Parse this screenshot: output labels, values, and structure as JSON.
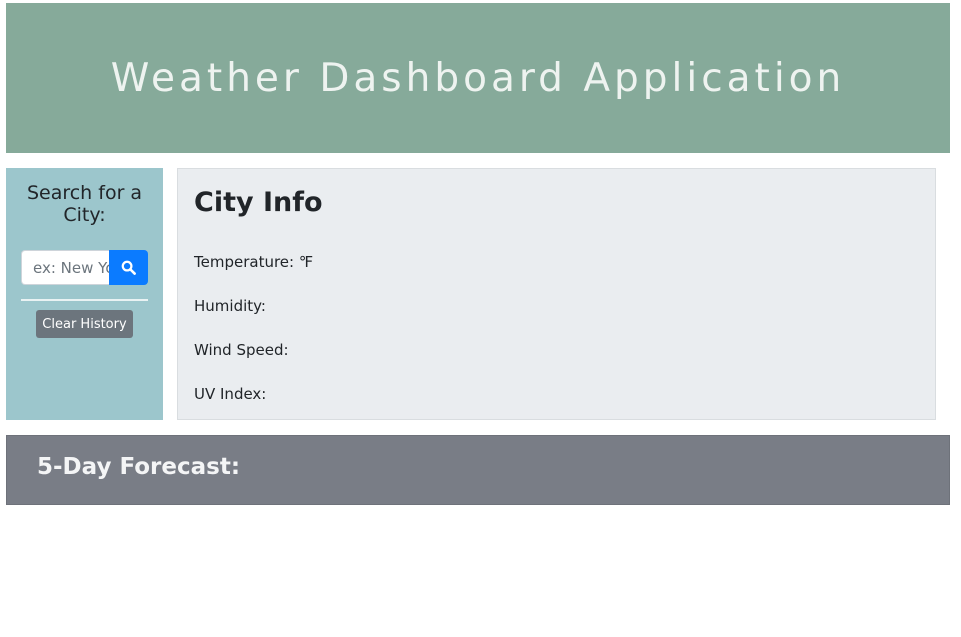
{
  "header": {
    "title": "Weather Dashboard Application"
  },
  "sidebar": {
    "title": "Search for a City:",
    "search": {
      "placeholder": "ex: New York",
      "value": ""
    },
    "search_button_icon": "search-icon",
    "clear_history_label": "Clear History"
  },
  "city_info": {
    "title": "City Info",
    "temperature_label": "Temperature: ℉",
    "humidity_label": "Humidity:",
    "wind_speed_label": "Wind Speed:",
    "uv_index_label": "UV Index:"
  },
  "forecast": {
    "title": "5-Day Forecast:"
  },
  "colors": {
    "header_bg": "#86aa9a",
    "sidebar_bg": "#9cc6cc",
    "search_button_bg": "#0b7bff",
    "clear_button_bg": "#6c757d",
    "city_panel_bg": "#eaedf0",
    "forecast_bg": "#797d86"
  }
}
